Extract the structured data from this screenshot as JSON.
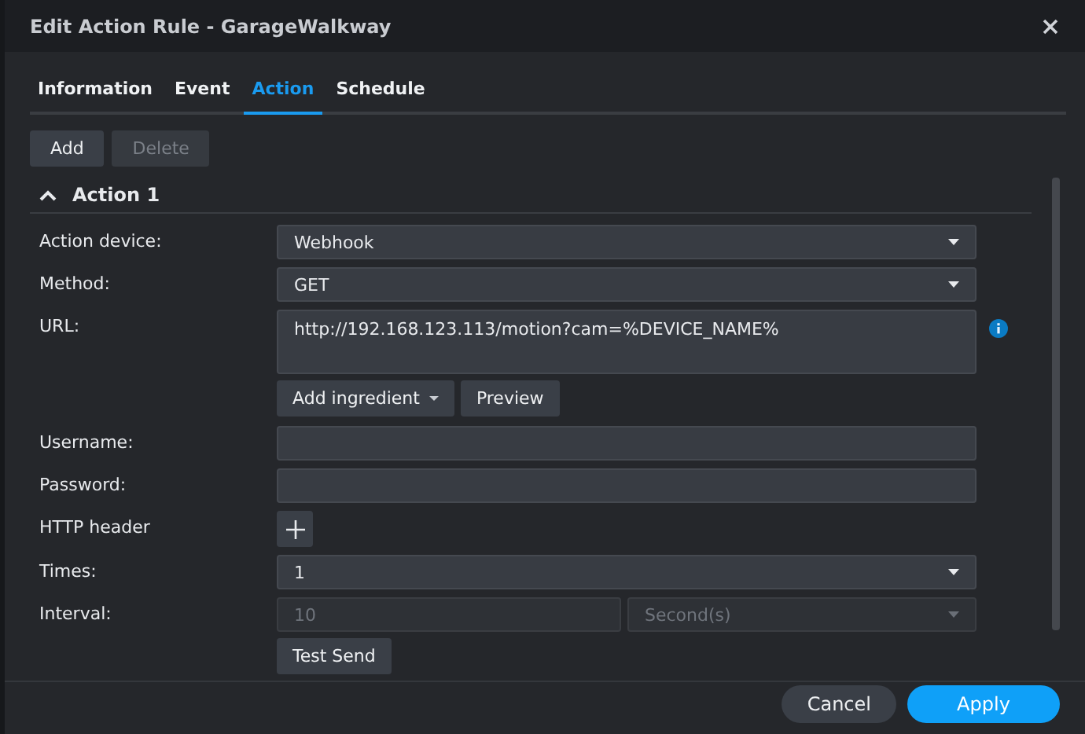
{
  "window": {
    "title": "Edit Action Rule - GarageWalkway"
  },
  "tabs": [
    {
      "label": "Information",
      "selected": false
    },
    {
      "label": "Event",
      "selected": false
    },
    {
      "label": "Action",
      "selected": true
    },
    {
      "label": "Schedule",
      "selected": false
    }
  ],
  "toolbar": [
    {
      "label": "Add",
      "disabled": false
    },
    {
      "label": "Delete",
      "disabled": true
    }
  ],
  "section": {
    "title": "Action 1",
    "expanded": true
  },
  "form": [
    {
      "kind": "select",
      "label": "Action device:",
      "value": "Webhook"
    },
    {
      "kind": "select",
      "label": "Method:",
      "value": "GET"
    },
    {
      "kind": "textarea",
      "label": "URL:",
      "value": "http://192.168.123.113/motion?cam=%DEVICE_NAME%",
      "info": true
    },
    {
      "kind": "buttons",
      "buttons": [
        {
          "label": "Add ingredient",
          "dropdown": true
        },
        {
          "label": "Preview",
          "dropdown": false
        }
      ]
    },
    {
      "kind": "input",
      "label": "Username:"
    },
    {
      "kind": "input",
      "label": "Password:"
    },
    {
      "kind": "add",
      "label": "HTTP header"
    },
    {
      "kind": "select",
      "label": "Times:",
      "value": "1"
    },
    {
      "kind": "interval",
      "label": "Interval:",
      "value": "10",
      "unit": "Second(s)",
      "disabled": true
    },
    {
      "kind": "buttons",
      "buttons": [
        {
          "label": "Test Send",
          "dropdown": false
        }
      ]
    }
  ],
  "footer": [
    {
      "label": "Cancel",
      "primary": false
    },
    {
      "label": "Apply",
      "primary": true
    }
  ]
}
